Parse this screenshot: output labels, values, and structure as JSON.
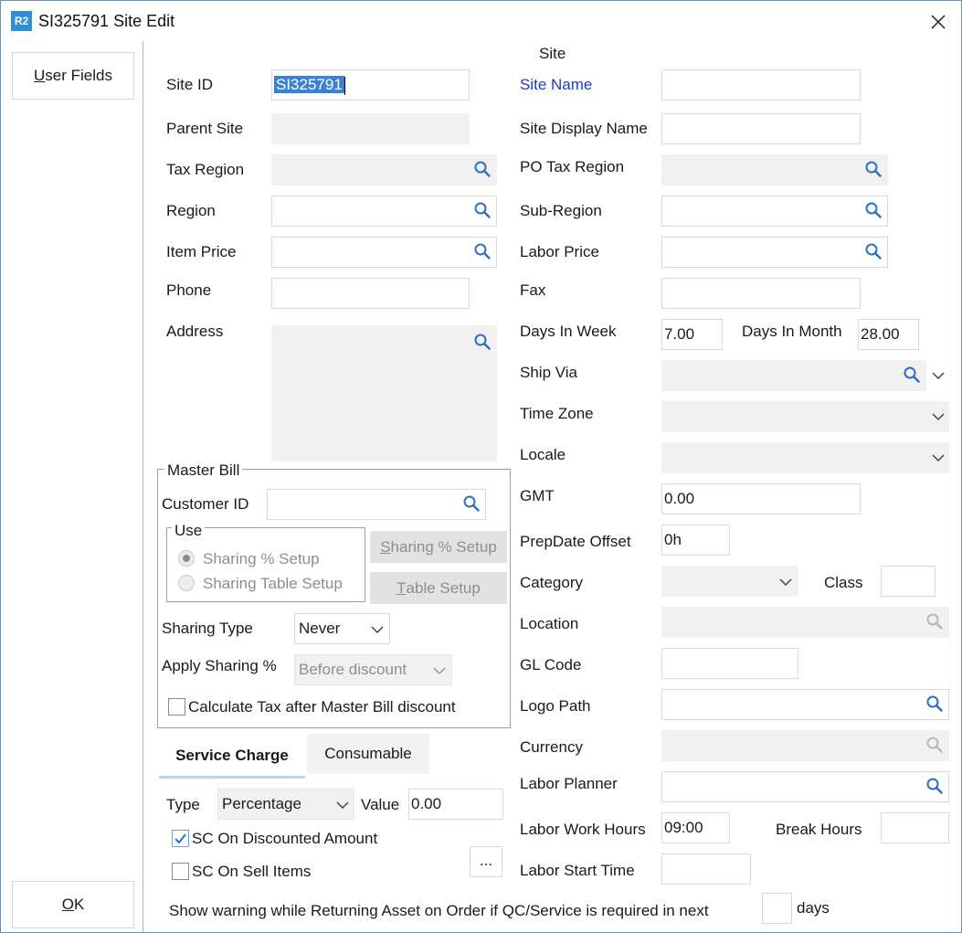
{
  "window": {
    "logo": "R2",
    "title": "SI325791 Site Edit"
  },
  "sidebar": {
    "user_fields_prefix": "U",
    "user_fields_rest": "ser Fields",
    "ok_prefix": "O",
    "ok_rest": "K"
  },
  "section_title": "Site",
  "left": {
    "site_id_label": "Site ID",
    "site_id_value": "SI325791",
    "parent_site_label": "Parent Site",
    "tax_region_label": "Tax Region",
    "region_label": "Region",
    "item_price_label": "Item Price",
    "phone_label": "Phone",
    "address_label": "Address"
  },
  "master_bill": {
    "legend": "Master Bill",
    "customer_id_label": "Customer ID",
    "use_legend": "Use",
    "radio_sharing_setup": "Sharing % Setup",
    "radio_sharing_table": "Sharing Table Setup",
    "btn_sharing_prefix": "S",
    "btn_sharing_rest": "haring % Setup",
    "btn_table_prefix": "T",
    "btn_table_rest": "able Setup",
    "sharing_type_label": "Sharing Type",
    "sharing_type_value": "Never",
    "apply_sharing_label": "Apply Sharing %",
    "apply_sharing_value": "Before discount",
    "calc_tax_label": "Calculate Tax after Master Bill discount"
  },
  "tabs": {
    "service_charge": "Service Charge",
    "consumable": "Consumable"
  },
  "service_charge": {
    "type_label": "Type",
    "type_value": "Percentage",
    "value_label": "Value",
    "value_value": "0.00",
    "sc_discounted_label": "SC On Discounted Amount",
    "sc_sell_label": "SC On Sell Items",
    "more_label": "..."
  },
  "right": {
    "site_name_label": "Site Name",
    "site_display_label": "Site Display Name",
    "po_tax_label": "PO Tax Region",
    "sub_region_label": "Sub-Region",
    "labor_price_label": "Labor Price",
    "fax_label": "Fax",
    "days_week_label": "Days In Week",
    "days_week_value": "7.00",
    "days_month_label": "Days In Month",
    "days_month_value": "28.00",
    "ship_via_label": "Ship Via",
    "time_zone_label": "Time Zone",
    "locale_label": "Locale",
    "gmt_label": "GMT",
    "gmt_value": "0.00",
    "prep_label": "PrepDate Offset",
    "prep_value": "0h",
    "category_label": "Category",
    "class_label": "Class",
    "location_label": "Location",
    "gl_code_label": "GL Code",
    "logo_path_label": "Logo Path",
    "currency_label": "Currency",
    "labor_planner_label": "Labor Planner",
    "labor_work_label": "Labor Work Hours",
    "labor_work_value": "09:00",
    "break_hours_label": "Break Hours",
    "labor_start_label": "Labor Start Time"
  },
  "bottom": {
    "warning_text": "Show warning while Returning Asset on Order if QC/Service is required in next",
    "days_label": "days"
  },
  "colors": {
    "accent": "#2f8ed6",
    "link_label": "#1a3ccc",
    "selection": "#3a82d6",
    "search_icon": "#2a6fc4"
  }
}
